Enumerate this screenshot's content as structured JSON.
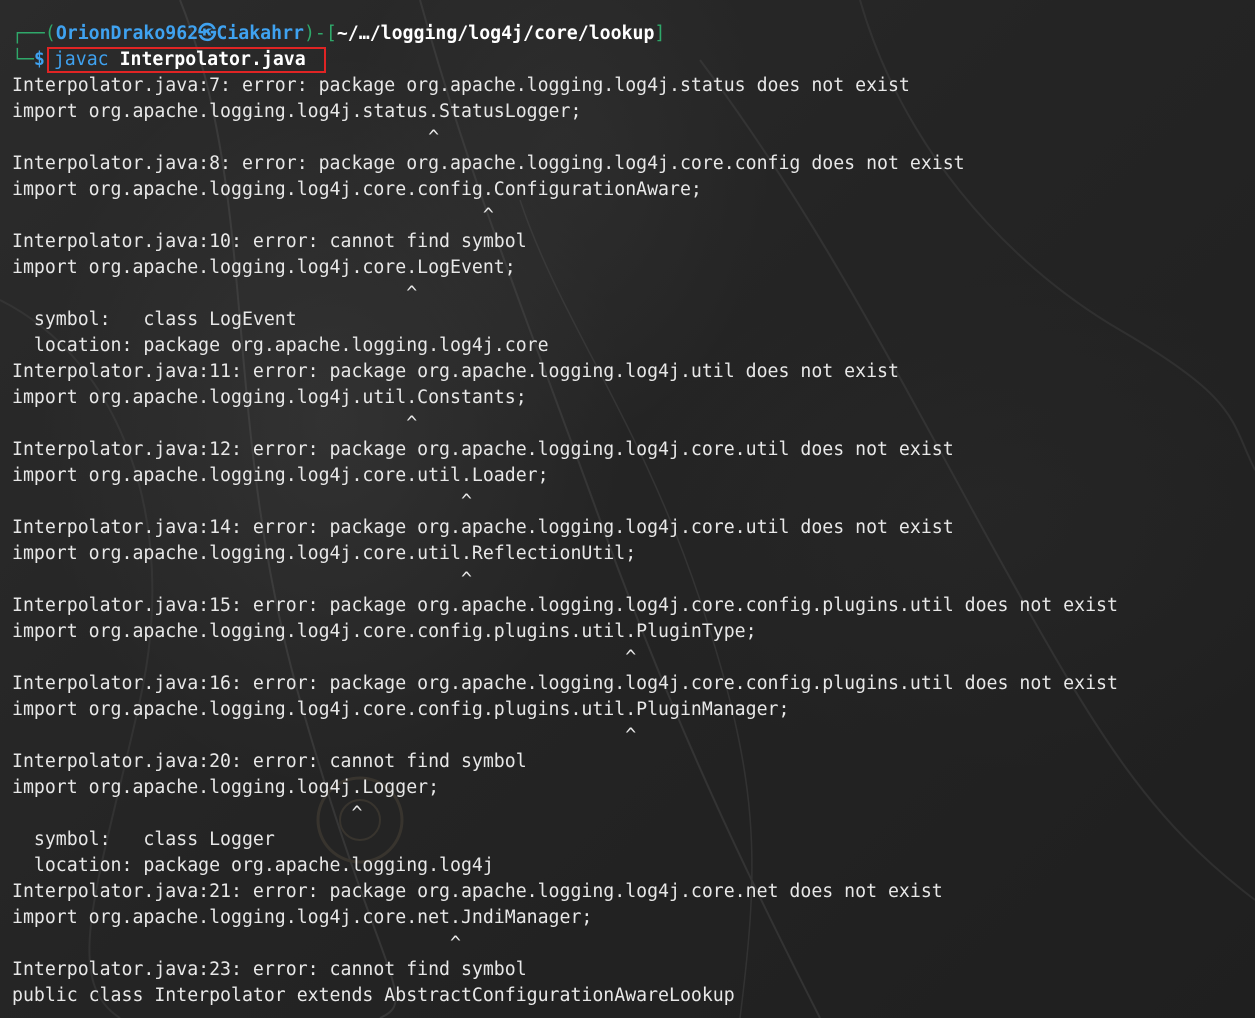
{
  "prompt": {
    "frame_top": "┌──(",
    "user": "OrionDrako962",
    "skull": "㉿",
    "host": "Ciakahrr",
    "frame_mid": ")-[",
    "path": "~/…/logging/log4j/core/lookup",
    "frame_end": "]",
    "frame_bottom": "└─",
    "dollar": "$",
    "command": "javac",
    "argument": "Interpolator.java"
  },
  "output_lines": [
    "Interpolator.java:7: error: package org.apache.logging.log4j.status does not exist",
    "import org.apache.logging.log4j.status.StatusLogger;",
    "                                      ^",
    "Interpolator.java:8: error: package org.apache.logging.log4j.core.config does not exist",
    "import org.apache.logging.log4j.core.config.ConfigurationAware;",
    "                                           ^",
    "Interpolator.java:10: error: cannot find symbol",
    "import org.apache.logging.log4j.core.LogEvent;",
    "                                    ^",
    "  symbol:   class LogEvent",
    "  location: package org.apache.logging.log4j.core",
    "Interpolator.java:11: error: package org.apache.logging.log4j.util does not exist",
    "import org.apache.logging.log4j.util.Constants;",
    "                                    ^",
    "Interpolator.java:12: error: package org.apache.logging.log4j.core.util does not exist",
    "import org.apache.logging.log4j.core.util.Loader;",
    "                                         ^",
    "Interpolator.java:14: error: package org.apache.logging.log4j.core.util does not exist",
    "import org.apache.logging.log4j.core.util.ReflectionUtil;",
    "                                         ^",
    "Interpolator.java:15: error: package org.apache.logging.log4j.core.config.plugins.util does not exist",
    "import org.apache.logging.log4j.core.config.plugins.util.PluginType;",
    "                                                        ^",
    "Interpolator.java:16: error: package org.apache.logging.log4j.core.config.plugins.util does not exist",
    "import org.apache.logging.log4j.core.config.plugins.util.PluginManager;",
    "                                                        ^",
    "Interpolator.java:20: error: cannot find symbol",
    "import org.apache.logging.log4j.Logger;",
    "                               ^",
    "  symbol:   class Logger",
    "  location: package org.apache.logging.log4j",
    "Interpolator.java:21: error: package org.apache.logging.log4j.core.net does not exist",
    "import org.apache.logging.log4j.core.net.JndiManager;",
    "                                        ^",
    "Interpolator.java:23: error: cannot find symbol",
    "public class Interpolator extends AbstractConfigurationAwareLookup"
  ],
  "colors": {
    "background": "#262626",
    "text": "#e8e8e8",
    "frame": "#2fa86a",
    "accent_blue": "#3fa2f0",
    "highlight_box": "#e02424"
  }
}
